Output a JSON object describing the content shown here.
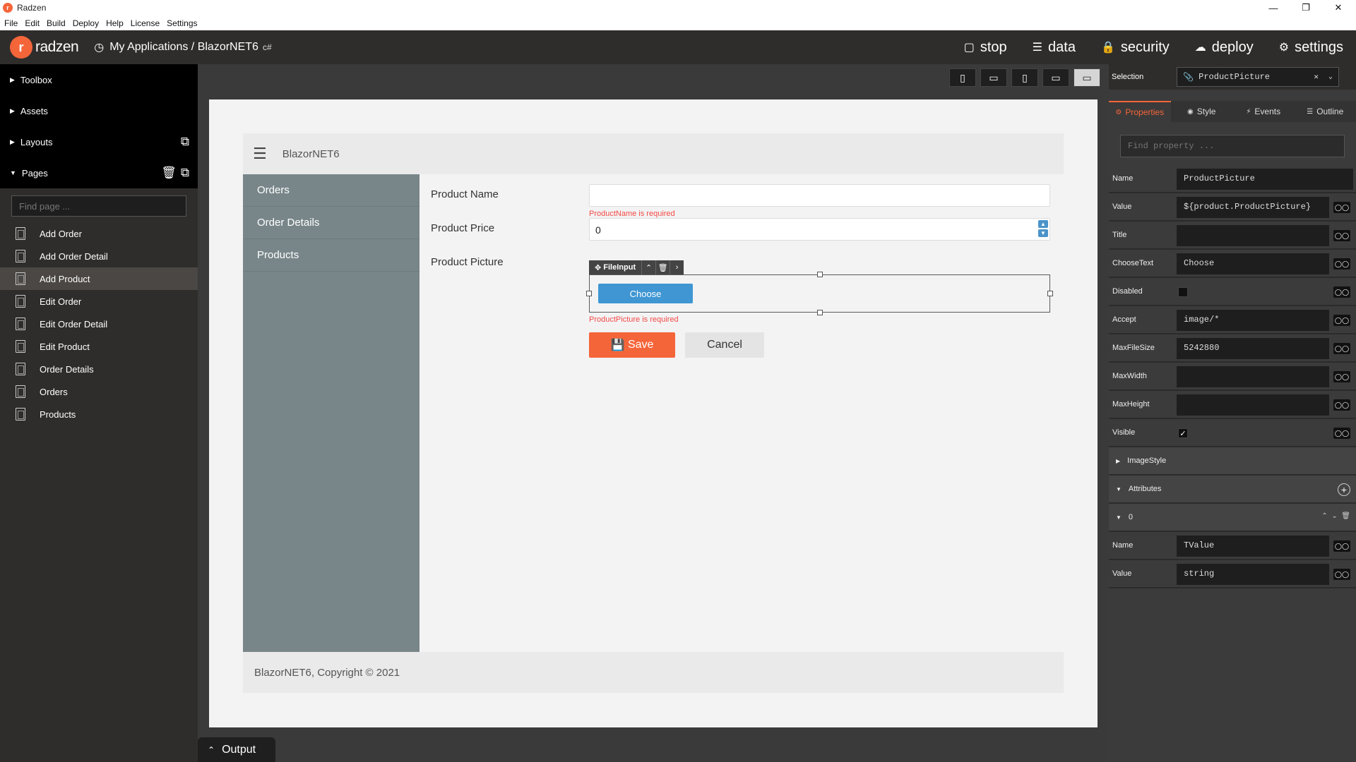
{
  "window": {
    "title": "Radzen",
    "menu": [
      "File",
      "Edit",
      "Build",
      "Deploy",
      "Help",
      "License",
      "Settings"
    ]
  },
  "header": {
    "brand": "radzen",
    "breadcrumb": "My Applications / BlazorNET6",
    "lang_badge": "c#",
    "nav": [
      "stop",
      "data",
      "security",
      "deploy",
      "settings"
    ]
  },
  "left": {
    "sections": {
      "toolbox": "Toolbox",
      "assets": "Assets",
      "layouts": "Layouts",
      "pages": "Pages"
    },
    "find_placeholder": "Find page ...",
    "pages": [
      "Add Order",
      "Add Order Detail",
      "Add Product",
      "Edit Order",
      "Edit Order Detail",
      "Edit Product",
      "Order Details",
      "Orders",
      "Products"
    ],
    "active_page": "Add Product"
  },
  "canvas": {
    "app_title": "BlazorNET6",
    "nav": [
      "Orders",
      "Order Details",
      "Products"
    ],
    "footer": "BlazorNET6, Copyright © 2021",
    "form": {
      "name_label": "Product Name",
      "name_value": "",
      "name_error": "ProductName is required",
      "price_label": "Product Price",
      "price_value": "0",
      "picture_label": "Product Picture",
      "choose_label": "Choose",
      "picture_error": "ProductPicture is required",
      "component_name": "FileInput",
      "save_label": "Save",
      "cancel_label": "Cancel"
    }
  },
  "output": {
    "label": "Output"
  },
  "right": {
    "selection_label": "Selection",
    "selection_value": "ProductPicture",
    "tabs": [
      "Properties",
      "Style",
      "Events",
      "Outline"
    ],
    "find_placeholder": "Find property ...",
    "props": {
      "name": {
        "label": "Name",
        "value": "ProductPicture"
      },
      "value": {
        "label": "Value",
        "value": "${product.ProductPicture}"
      },
      "title": {
        "label": "Title",
        "value": ""
      },
      "choosetext": {
        "label": "ChooseText",
        "value": "Choose"
      },
      "disabled": {
        "label": "Disabled",
        "checked": false
      },
      "accept": {
        "label": "Accept",
        "value": "image/*"
      },
      "maxfilesize": {
        "label": "MaxFileSize",
        "value": "5242880"
      },
      "maxwidth": {
        "label": "MaxWidth",
        "value": ""
      },
      "maxheight": {
        "label": "MaxHeight",
        "value": ""
      },
      "visible": {
        "label": "Visible",
        "checked": true
      },
      "imagestyle": {
        "label": "ImageStyle"
      },
      "attributes": {
        "label": "Attributes"
      },
      "attr_index": "0",
      "attr_name": {
        "label": "Name",
        "value": "TValue"
      },
      "attr_value": {
        "label": "Value",
        "value": "string"
      }
    }
  },
  "colors": {
    "accent": "#f5653a",
    "choose_button": "#3f96d3",
    "nav_bg": "#78868a",
    "error": "#f34a46"
  }
}
